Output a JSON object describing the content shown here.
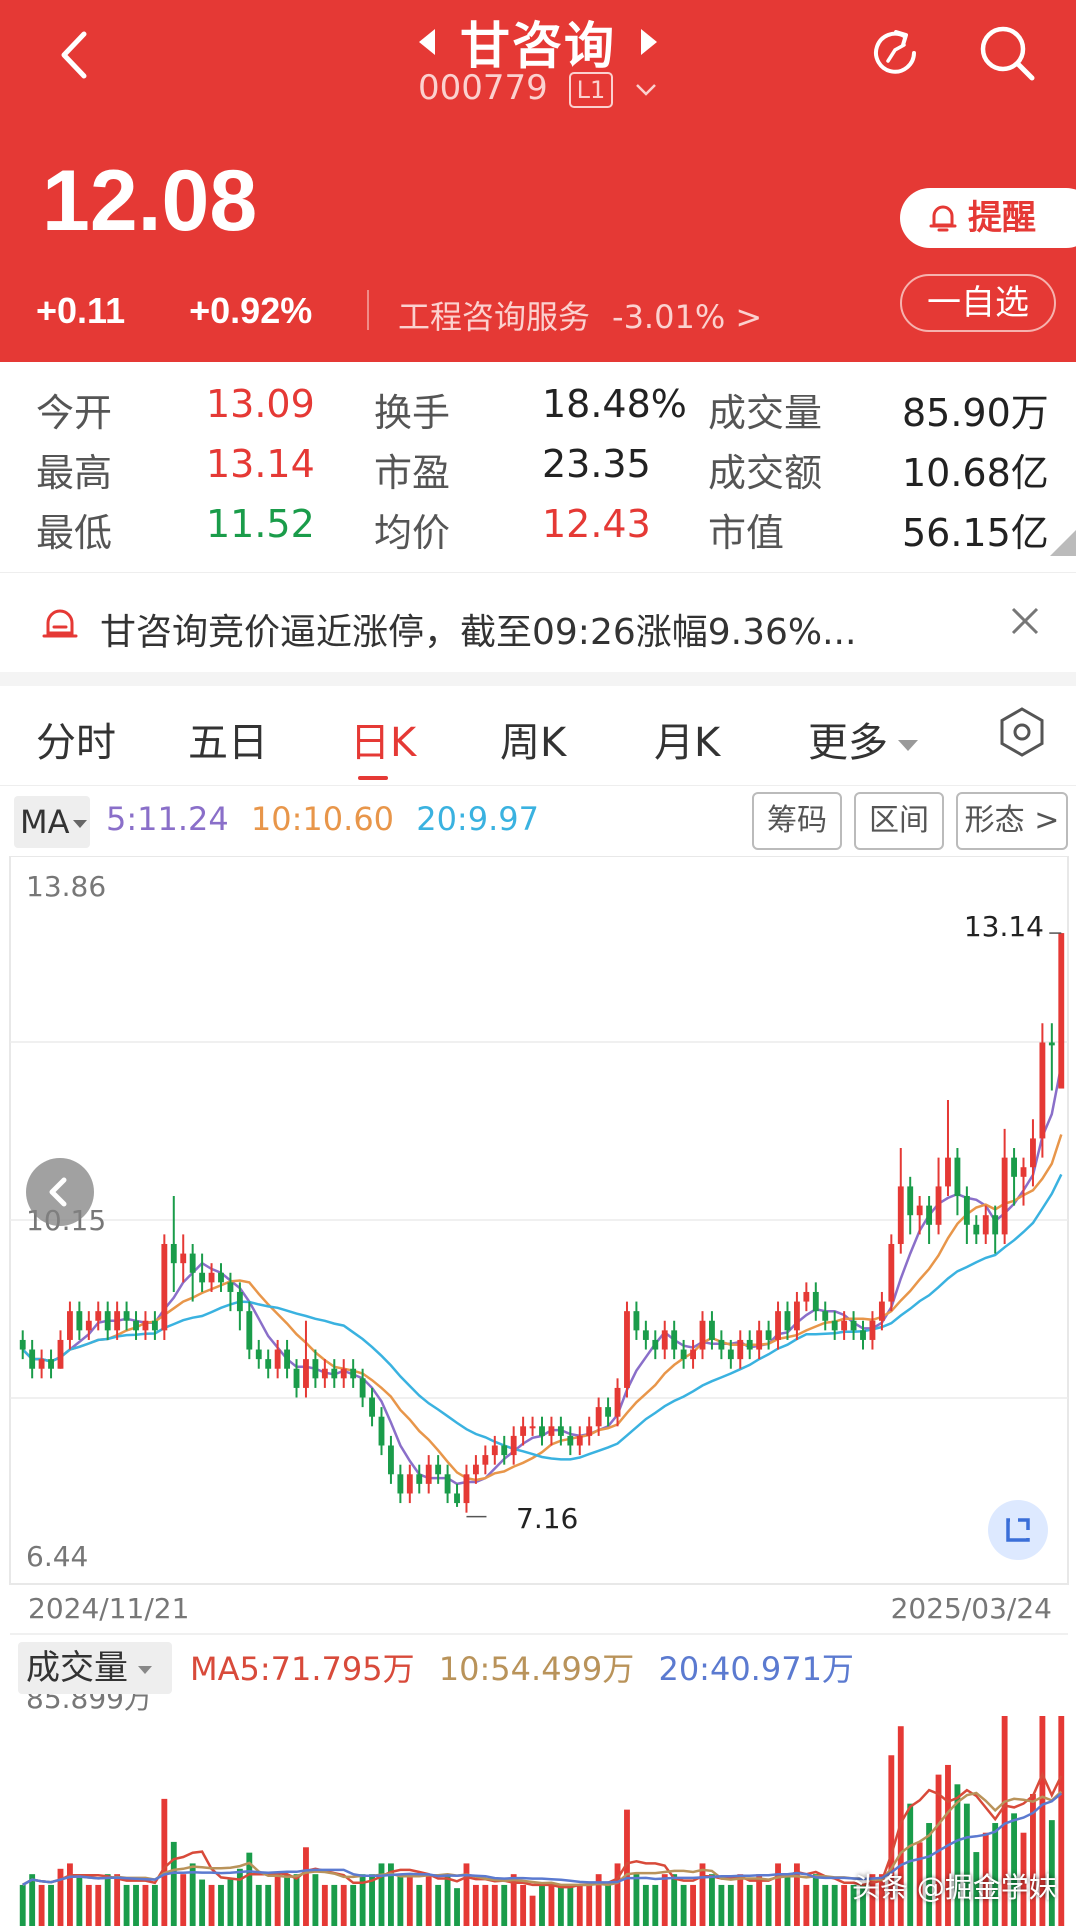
{
  "header": {
    "stock_name": "甘咨询",
    "stock_code": "000779",
    "level": "L1",
    "price": "12.08",
    "change": "+0.11",
    "change_pct": "+0.92%",
    "sector_name": "工程咨询服务",
    "sector_pct": "-3.01%",
    "sector_arrow": ">",
    "alert_label": "提醒",
    "watchlist_label": "一自选"
  },
  "colors": {
    "header_bg": "#e53935",
    "up": "#e53935",
    "down": "#1a9c4a",
    "ma5": "#8a6fc9",
    "ma10": "#e8964a",
    "ma20": "#3ab2e0"
  },
  "stats": [
    {
      "label": "今开",
      "value": "13.09",
      "tone": "up"
    },
    {
      "label": "换手",
      "value": "18.48%",
      "tone": "neutral"
    },
    {
      "label": "成交量",
      "value": "85.90万",
      "tone": "neutral"
    },
    {
      "label": "最高",
      "value": "13.14",
      "tone": "up"
    },
    {
      "label": "市盈",
      "value": "23.35",
      "tone": "neutral"
    },
    {
      "label": "成交额",
      "value": "10.68亿",
      "tone": "neutral"
    },
    {
      "label": "最低",
      "value": "11.52",
      "tone": "down"
    },
    {
      "label": "均价",
      "value": "12.43",
      "tone": "up"
    },
    {
      "label": "市值",
      "value": "56.15亿",
      "tone": "neutral"
    }
  ],
  "notice": {
    "text": "甘咨询竞价逼近涨停，截至09:26涨幅9.36%..."
  },
  "tabs": [
    "分时",
    "五日",
    "日K",
    "周K",
    "月K",
    "更多"
  ],
  "active_tab": "日K",
  "ma": {
    "label": "MA",
    "ma5": "5:11.24",
    "ma10": "10:10.60",
    "ma20": "20:9.97"
  },
  "tools": [
    "筹码",
    "区间",
    "形态 >"
  ],
  "kline": {
    "y_max_label": "13.86",
    "y_mid_label": "10.15",
    "y_min_label": "6.44",
    "high_label": "13.14",
    "low_label": "7.16",
    "start_date": "2024/11/21",
    "end_date": "2025/03/24"
  },
  "volume": {
    "label": "成交量",
    "ma5": "MA5:71.795万",
    "ma10": "10:54.499万",
    "ma20": "20:40.971万",
    "max_label": "85.899万"
  },
  "watermark": "头条 @掘金学妹",
  "chart_data": {
    "type": "candlestick",
    "x_range": [
      "2024/11/21",
      "2025/03/24"
    ],
    "y_axis_ticks": [
      13.86,
      10.15,
      6.44
    ],
    "candles": [
      [
        8.9,
        8.8,
        9.0,
        8.7
      ],
      [
        8.8,
        8.6,
        8.9,
        8.5
      ],
      [
        8.6,
        8.7,
        8.8,
        8.5
      ],
      [
        8.7,
        8.6,
        8.8,
        8.5
      ],
      [
        8.6,
        8.9,
        9.0,
        8.6
      ],
      [
        8.9,
        9.2,
        9.3,
        8.8
      ],
      [
        9.2,
        9.0,
        9.3,
        8.9
      ],
      [
        9.0,
        9.1,
        9.2,
        8.9
      ],
      [
        9.1,
        9.2,
        9.3,
        9.0
      ],
      [
        9.2,
        9.0,
        9.3,
        8.9
      ],
      [
        9.0,
        9.2,
        9.3,
        8.9
      ],
      [
        9.2,
        9.1,
        9.3,
        9.0
      ],
      [
        9.1,
        9.0,
        9.2,
        8.9
      ],
      [
        9.0,
        9.1,
        9.2,
        8.9
      ],
      [
        9.1,
        9.0,
        9.2,
        8.9
      ],
      [
        9.0,
        9.9,
        10.0,
        8.9
      ],
      [
        9.9,
        9.7,
        10.4,
        9.4
      ],
      [
        9.7,
        9.8,
        10.0,
        9.5
      ],
      [
        9.8,
        9.6,
        9.9,
        9.3
      ],
      [
        9.6,
        9.5,
        9.8,
        9.4
      ],
      [
        9.5,
        9.6,
        9.7,
        9.4
      ],
      [
        9.6,
        9.5,
        9.7,
        9.4
      ],
      [
        9.5,
        9.4,
        9.6,
        9.2
      ],
      [
        9.4,
        9.2,
        9.5,
        9.0
      ],
      [
        9.2,
        8.8,
        9.3,
        8.7
      ],
      [
        8.8,
        8.7,
        8.9,
        8.6
      ],
      [
        8.7,
        8.6,
        8.8,
        8.5
      ],
      [
        8.6,
        8.8,
        8.9,
        8.5
      ],
      [
        8.8,
        8.6,
        8.9,
        8.5
      ],
      [
        8.6,
        8.4,
        8.7,
        8.3
      ],
      [
        8.4,
        8.7,
        9.1,
        8.3
      ],
      [
        8.7,
        8.5,
        8.8,
        8.4
      ],
      [
        8.5,
        8.6,
        8.7,
        8.4
      ],
      [
        8.6,
        8.5,
        8.7,
        8.4
      ],
      [
        8.5,
        8.6,
        8.7,
        8.4
      ],
      [
        8.6,
        8.5,
        8.7,
        8.4
      ],
      [
        8.5,
        8.3,
        8.6,
        8.2
      ],
      [
        8.3,
        8.1,
        8.4,
        8.0
      ],
      [
        8.1,
        7.8,
        8.2,
        7.7
      ],
      [
        7.8,
        7.5,
        7.9,
        7.4
      ],
      [
        7.5,
        7.3,
        7.6,
        7.2
      ],
      [
        7.3,
        7.5,
        7.6,
        7.2
      ],
      [
        7.5,
        7.4,
        7.6,
        7.3
      ],
      [
        7.4,
        7.6,
        7.7,
        7.3
      ],
      [
        7.6,
        7.5,
        7.7,
        7.4
      ],
      [
        7.5,
        7.3,
        7.6,
        7.2
      ],
      [
        7.3,
        7.2,
        7.4,
        7.16
      ],
      [
        7.2,
        7.5,
        7.6,
        7.1
      ],
      [
        7.5,
        7.6,
        7.7,
        7.4
      ],
      [
        7.6,
        7.7,
        7.8,
        7.5
      ],
      [
        7.7,
        7.8,
        7.9,
        7.6
      ],
      [
        7.8,
        7.7,
        7.9,
        7.6
      ],
      [
        7.7,
        7.9,
        8.0,
        7.6
      ],
      [
        7.9,
        8.0,
        8.1,
        7.8
      ],
      [
        8.0,
        8.0,
        8.1,
        7.9
      ],
      [
        8.0,
        7.9,
        8.1,
        7.8
      ],
      [
        7.9,
        8.0,
        8.1,
        7.8
      ],
      [
        8.0,
        7.9,
        8.1,
        7.8
      ],
      [
        7.9,
        7.8,
        8.0,
        7.7
      ],
      [
        7.8,
        7.9,
        8.0,
        7.7
      ],
      [
        7.9,
        8.0,
        8.1,
        7.8
      ],
      [
        8.0,
        8.2,
        8.3,
        7.9
      ],
      [
        8.2,
        8.1,
        8.3,
        8.0
      ],
      [
        8.1,
        8.4,
        8.5,
        8.0
      ],
      [
        8.4,
        9.2,
        9.3,
        8.3
      ],
      [
        9.2,
        9.0,
        9.3,
        8.9
      ],
      [
        9.0,
        8.9,
        9.1,
        8.8
      ],
      [
        8.9,
        8.8,
        9.0,
        8.7
      ],
      [
        8.8,
        9.0,
        9.1,
        8.7
      ],
      [
        9.0,
        8.8,
        9.1,
        8.7
      ],
      [
        8.8,
        8.7,
        8.9,
        8.6
      ],
      [
        8.7,
        8.8,
        8.9,
        8.6
      ],
      [
        8.8,
        9.1,
        9.2,
        8.7
      ],
      [
        9.1,
        8.9,
        9.2,
        8.8
      ],
      [
        8.9,
        8.8,
        9.0,
        8.7
      ],
      [
        8.8,
        8.7,
        8.9,
        8.6
      ],
      [
        8.7,
        8.9,
        9.0,
        8.6
      ],
      [
        8.9,
        8.8,
        9.0,
        8.7
      ],
      [
        8.8,
        9.0,
        9.1,
        8.7
      ],
      [
        9.0,
        8.9,
        9.1,
        8.8
      ],
      [
        8.9,
        9.2,
        9.3,
        8.8
      ],
      [
        9.2,
        9.0,
        9.3,
        8.9
      ],
      [
        9.0,
        9.3,
        9.4,
        8.9
      ],
      [
        9.3,
        9.4,
        9.5,
        9.2
      ],
      [
        9.4,
        9.2,
        9.5,
        9.1
      ],
      [
        9.2,
        9.1,
        9.3,
        9.0
      ],
      [
        9.1,
        9.0,
        9.2,
        8.9
      ],
      [
        9.0,
        9.1,
        9.2,
        8.9
      ],
      [
        9.1,
        9.0,
        9.2,
        8.9
      ],
      [
        9.0,
        8.9,
        9.1,
        8.8
      ],
      [
        8.9,
        9.1,
        9.2,
        8.8
      ],
      [
        9.1,
        9.3,
        9.4,
        9.0
      ],
      [
        9.3,
        9.9,
        10.0,
        9.2
      ],
      [
        9.9,
        10.5,
        10.9,
        9.8
      ],
      [
        10.5,
        10.2,
        10.6,
        10.0
      ],
      [
        10.2,
        10.3,
        10.4,
        10.0
      ],
      [
        10.3,
        10.1,
        10.4,
        9.9
      ],
      [
        10.1,
        10.5,
        10.8,
        10.0
      ],
      [
        10.5,
        10.8,
        11.4,
        10.4
      ],
      [
        10.8,
        10.4,
        10.9,
        10.2
      ],
      [
        10.4,
        10.1,
        10.5,
        9.9
      ],
      [
        10.1,
        10.0,
        10.2,
        9.9
      ],
      [
        10.0,
        10.2,
        10.3,
        9.9
      ],
      [
        10.2,
        10.0,
        10.3,
        9.8
      ],
      [
        10.0,
        10.8,
        11.1,
        9.9
      ],
      [
        10.8,
        10.6,
        10.9,
        10.3
      ],
      [
        10.6,
        10.7,
        10.8,
        10.3
      ],
      [
        10.7,
        11.0,
        11.2,
        10.5
      ],
      [
        11.0,
        12.0,
        12.2,
        10.8
      ],
      [
        12.0,
        11.97,
        12.2,
        11.5
      ],
      [
        11.52,
        13.14,
        13.14,
        11.52
      ]
    ],
    "ma5_end": 11.24,
    "ma10_end": 10.6,
    "ma20_end": 9.97,
    "high": 13.14,
    "low": 7.16,
    "volume_max": 85.899,
    "volume_unit": "万",
    "volume_ma5": 71.795,
    "volume_ma10": 54.499,
    "volume_ma20": 40.971
  }
}
